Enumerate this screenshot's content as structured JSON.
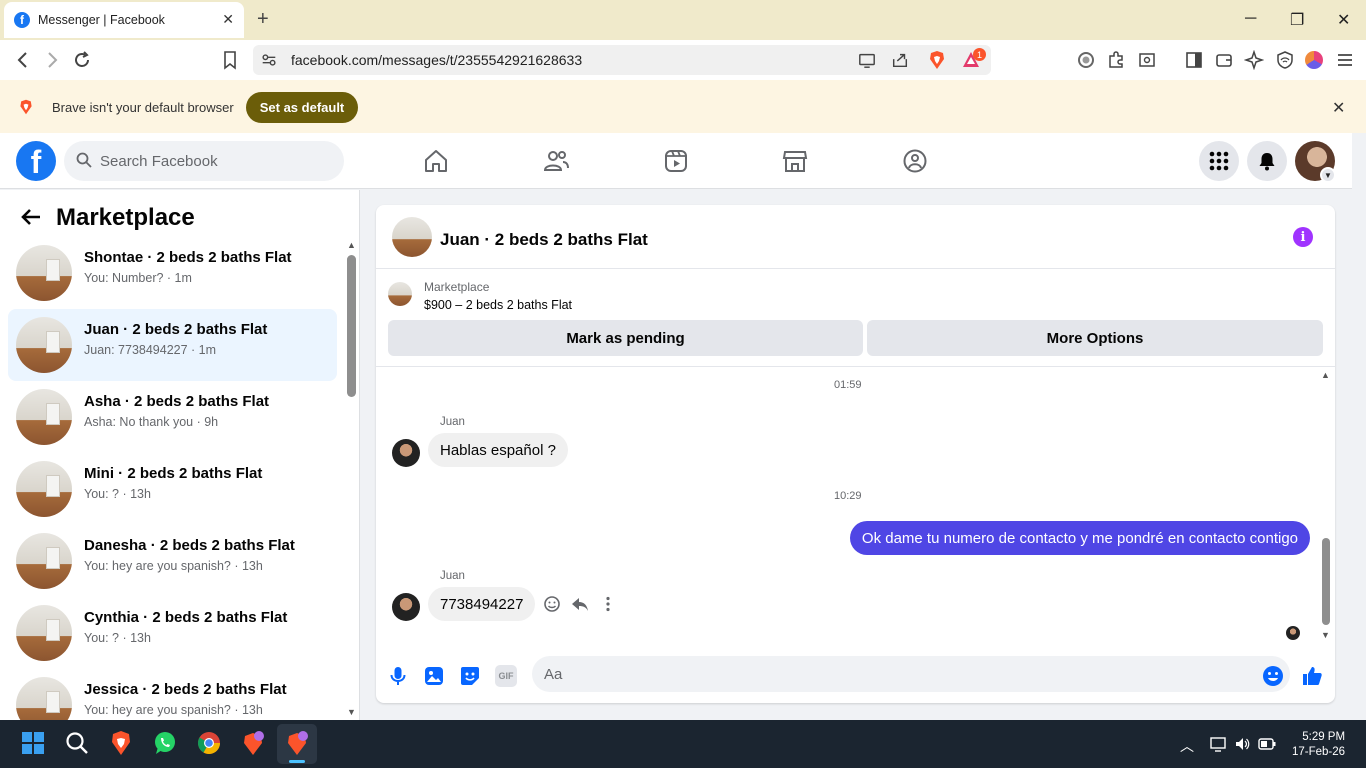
{
  "browser": {
    "tab_title": "Messenger | Facebook",
    "url": "facebook.com/messages/t/2355542921628633",
    "brave_badge": "1",
    "infobar_text": "Brave isn't your default browser",
    "set_default_label": "Set as default"
  },
  "fb": {
    "logo": "f",
    "search_placeholder": "Search Facebook"
  },
  "sidebar": {
    "title": "Marketplace",
    "conversations": [
      {
        "name": "Shontae · 2 beds 2 baths Flat",
        "sub": "You: Number? · 1m"
      },
      {
        "name": "Juan · 2 beds 2 baths Flat",
        "sub": "Juan: 7738494227 · 1m"
      },
      {
        "name": "Asha · 2 beds 2 baths Flat",
        "sub": "Asha: No thank you · 9h"
      },
      {
        "name": "Mini · 2 beds 2 baths Flat",
        "sub": "You: ? · 13h"
      },
      {
        "name": "Danesha · 2 beds 2 baths Flat",
        "sub": "You: hey are you spanish? · 13h"
      },
      {
        "name": "Cynthia · 2 beds 2 baths Flat",
        "sub": "You: ? · 13h"
      },
      {
        "name": "Jessica · 2 beds 2 baths Flat",
        "sub": "You: hey are you spanish? · 13h"
      }
    ]
  },
  "chat": {
    "title": "Juan · 2 beds 2 baths Flat",
    "marketplace_label": "Marketplace",
    "listing": "$900 – 2 beds 2 baths Flat",
    "mark_pending": "Mark as pending",
    "more_options": "More Options",
    "messages": {
      "time1": "01:59",
      "sender1": "Juan",
      "msg1": "Hablas español ?",
      "time2": "10:29",
      "msg2": "Ok dame tu numero de contacto y me pondré en contacto contigo",
      "sender3": "Juan",
      "msg3": "7738494227"
    },
    "composer_placeholder": "Aa",
    "gif_label": "GIF"
  },
  "taskbar": {
    "time": "5:29 PM",
    "date": "17-Feb-26"
  },
  "colors": {
    "fb_blue": "#1877f2",
    "outgoing_bubble": "#4f46e5",
    "info_purple": "#a033ff",
    "infobar_button": "#6b5d09"
  }
}
